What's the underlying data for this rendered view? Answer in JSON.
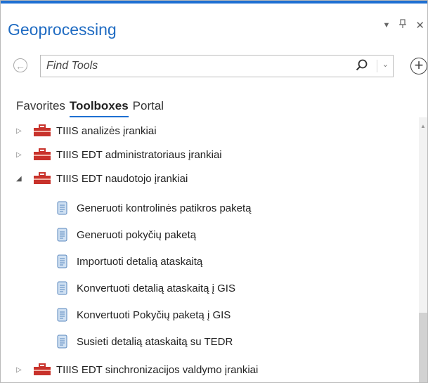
{
  "pane": {
    "title": "Geoprocessing",
    "pin_glyph": "⌄",
    "dock_glyph": "📌"
  },
  "search": {
    "placeholder": "Find Tools"
  },
  "tabs": [
    {
      "label": "Favorites",
      "active": false
    },
    {
      "label": "Toolboxes",
      "active": true
    },
    {
      "label": "Portal",
      "active": false
    }
  ],
  "tree": [
    {
      "type": "toolbox",
      "label": "TIIIS analizės įrankiai",
      "expanded": false
    },
    {
      "type": "toolbox",
      "label": "TIIIS EDT administratoriaus įrankiai",
      "expanded": false
    },
    {
      "type": "toolbox",
      "label": "TIIIS EDT naudotojo įrankiai",
      "expanded": true
    },
    {
      "type": "tool",
      "label": "Generuoti kontrolinės patikros paketą"
    },
    {
      "type": "tool",
      "label": "Generuoti pokyčių paketą"
    },
    {
      "type": "tool",
      "label": "Importuoti detalią ataskaitą"
    },
    {
      "type": "tool",
      "label": "Konvertuoti detalią ataskaitą į GIS"
    },
    {
      "type": "tool",
      "label": "Konvertuoti Pokyčių paketą į GIS"
    },
    {
      "type": "tool",
      "label": "Susieti detalią ataskaitą su TEDR"
    },
    {
      "type": "toolbox",
      "label": "TIIIS EDT sinchronizacijos valdymo įrankiai",
      "expanded": false
    }
  ],
  "colors": {
    "accent": "#1e6fd2",
    "toolbox_red": "#c8322b"
  },
  "icons": {
    "back": "back-arrow-icon",
    "search": "search-icon",
    "add": "add-circle-icon",
    "toolbox": "toolbox-icon",
    "tool": "script-tool-icon"
  }
}
